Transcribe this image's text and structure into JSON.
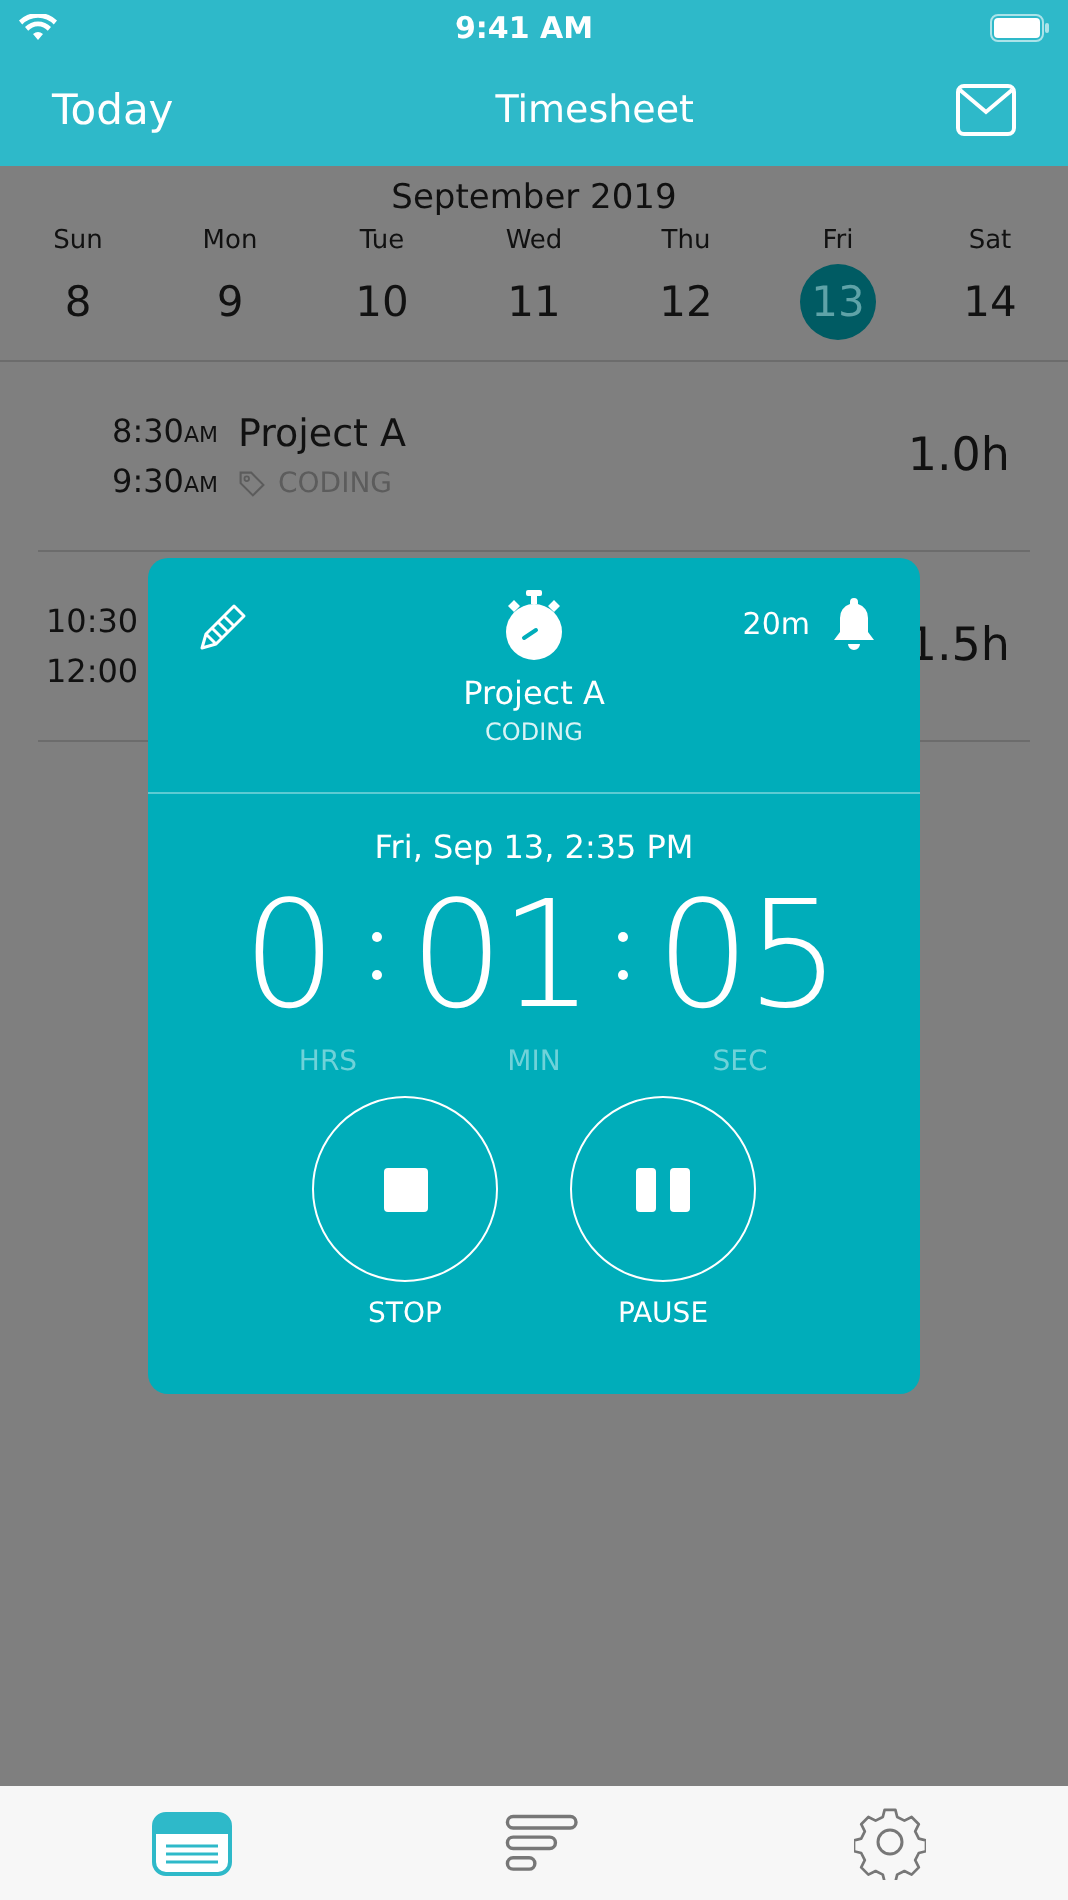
{
  "status_bar": {
    "time": "9:41 AM"
  },
  "nav": {
    "left": "Today",
    "title": "Timesheet"
  },
  "calendar": {
    "month": "September 2019",
    "days": [
      {
        "weekday": "Sun",
        "date": "8",
        "selected": false
      },
      {
        "weekday": "Mon",
        "date": "9",
        "selected": false
      },
      {
        "weekday": "Tue",
        "date": "10",
        "selected": false
      },
      {
        "weekday": "Wed",
        "date": "11",
        "selected": false
      },
      {
        "weekday": "Thu",
        "date": "12",
        "selected": false
      },
      {
        "weekday": "Fri",
        "date": "13",
        "selected": true
      },
      {
        "weekday": "Sat",
        "date": "14",
        "selected": false
      }
    ]
  },
  "entries": [
    {
      "start": "8:30",
      "start_ampm": "AM",
      "end": "9:30",
      "end_ampm": "AM",
      "project": "Project A",
      "tag": "CODING",
      "hours": "1.0h"
    },
    {
      "start": "10:30",
      "end": "12:00",
      "hours": "1.5h"
    }
  ],
  "timer": {
    "reminder": "20m",
    "project": "Project A",
    "tag": "CODING",
    "started": "Fri, Sep 13, 2:35 PM",
    "hours": "0",
    "minutes": "01",
    "seconds": "05",
    "units": [
      "HRS",
      "MIN",
      "SEC"
    ],
    "buttons": [
      {
        "kind": "stop",
        "label": "STOP"
      },
      {
        "kind": "pause",
        "label": "PAUSE"
      }
    ]
  },
  "tab_bar": [
    {
      "kind": "timesheet",
      "selected": true
    },
    {
      "kind": "reports",
      "selected": false
    },
    {
      "kind": "settings",
      "selected": false
    }
  ]
}
